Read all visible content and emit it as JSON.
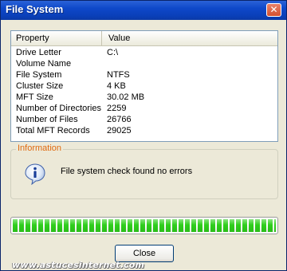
{
  "window": {
    "title": "File System",
    "close_glyph": "✕"
  },
  "table": {
    "headers": [
      "Property",
      "Value"
    ],
    "rows": [
      {
        "property": "Drive Letter",
        "value": "C:\\"
      },
      {
        "property": "Volume Name",
        "value": ""
      },
      {
        "property": "File System",
        "value": "NTFS"
      },
      {
        "property": "Cluster Size",
        "value": "4 KB"
      },
      {
        "property": "MFT Size",
        "value": "30.02 MB"
      },
      {
        "property": "Number of Directories",
        "value": "2259"
      },
      {
        "property": "Number of Files",
        "value": "26766"
      },
      {
        "property": "Total MFT Records",
        "value": "29025"
      }
    ]
  },
  "info": {
    "legend": "Information",
    "icon": "info-icon",
    "message": "File system check found no errors"
  },
  "progress": {
    "percent": 100,
    "color": "#2fcf1c"
  },
  "buttons": {
    "close_label": "Close"
  },
  "watermark": "www.astucesinternet.com",
  "colors": {
    "titlebar": "#0e48c9",
    "legend": "#e06a10",
    "window_bg": "#ece9d8"
  }
}
